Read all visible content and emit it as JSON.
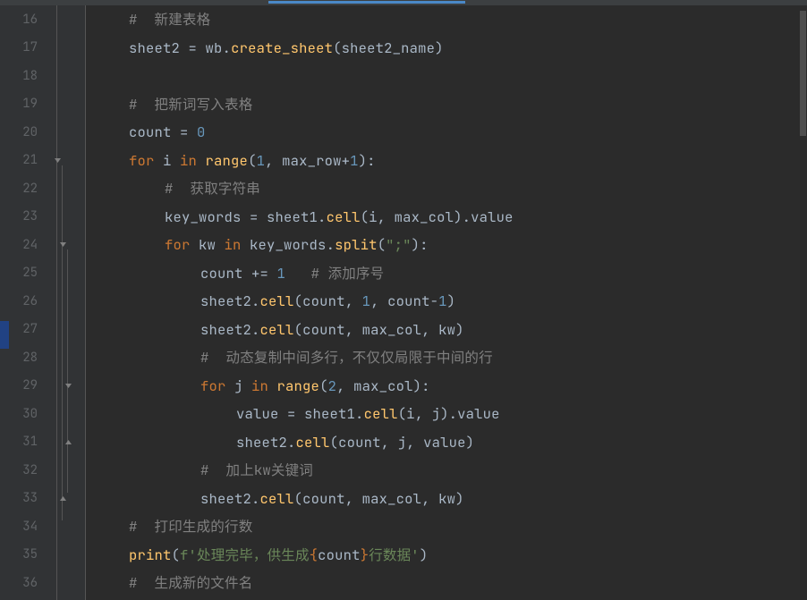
{
  "line_numbers": [
    "16",
    "17",
    "18",
    "19",
    "20",
    "21",
    "22",
    "23",
    "24",
    "25",
    "26",
    "27",
    "28",
    "29",
    "30",
    "31",
    "32",
    "33",
    "34",
    "35",
    "36"
  ],
  "code": {
    "l16": {
      "cmt": "#  新建表格"
    },
    "l17": {
      "v1": "sheet2 ",
      "op1": "= ",
      "v2": "wb",
      "dot": ".",
      "fn": "create_sheet",
      "lp": "(",
      "arg": "sheet2_name",
      "rp": ")"
    },
    "l18": {},
    "l19": {
      "cmt": "#  把新词写入表格"
    },
    "l20": {
      "v": "count ",
      "op": "= ",
      "n": "0"
    },
    "l21": {
      "kw1": "for ",
      "v1": "i ",
      "kw2": "in ",
      "fn": "range",
      "lp": "(",
      "n1": "1",
      "c1": ", ",
      "v2": "max_row",
      "plus": "+",
      "n2": "1",
      "rp": "):"
    },
    "l22": {
      "cmt": "#  获取字符串"
    },
    "l23": {
      "v1": "key_words ",
      "op": "= ",
      "v2": "sheet1",
      "dot1": ".",
      "fn1": "cell",
      "lp": "(",
      "a1": "i",
      "c1": ", ",
      "a2": "max_col",
      "rp": ")",
      "dot2": ".",
      "attr": "value"
    },
    "l24": {
      "kw1": "for ",
      "v1": "kw ",
      "kw2": "in ",
      "v2": "key_words",
      "dot": ".",
      "fn": "split",
      "lp": "(",
      "s": "\";\"",
      "rp": "):"
    },
    "l25": {
      "v": "count ",
      "op": "+= ",
      "n": "1",
      "sp": "   ",
      "cmt": "# 添加序号"
    },
    "l26": {
      "v1": "sheet2",
      "dot": ".",
      "fn": "cell",
      "lp": "(",
      "a1": "count",
      "c1": ", ",
      "n1": "1",
      "c2": ", ",
      "a2": "count",
      "minus": "-",
      "n2": "1",
      "rp": ")"
    },
    "l27": {
      "v1": "sheet2",
      "dot": ".",
      "fn": "cell",
      "lp": "(",
      "a1": "count",
      "c1": ", ",
      "a2": "max_col",
      "c2": ", ",
      "a3": "kw",
      "rp": ")"
    },
    "l28": {
      "cmt": "#  动态复制中间多行，不仅仅局限于中间的行"
    },
    "l29": {
      "kw1": "for ",
      "v1": "j ",
      "kw2": "in ",
      "fn": "range",
      "lp": "(",
      "n1": "2",
      "c1": ", ",
      "a1": "max_col",
      "rp": "):"
    },
    "l30": {
      "v1": "value ",
      "op": "= ",
      "v2": "sheet1",
      "dot": ".",
      "fn": "cell",
      "lp": "(",
      "a1": "i",
      "c1": ", ",
      "a2": "j",
      "rp": ")",
      "dot2": ".",
      "attr": "value"
    },
    "l31": {
      "v1": "sheet2",
      "dot": ".",
      "fn": "cell",
      "lp": "(",
      "a1": "count",
      "c1": ", ",
      "a2": "j",
      "c2": ", ",
      "a3": "value",
      "rp": ")"
    },
    "l32": {
      "cmt": "#  加上kw关键词"
    },
    "l33": {
      "v1": "sheet2",
      "dot": ".",
      "fn": "cell",
      "lp": "(",
      "a1": "count",
      "c1": ", ",
      "a2": "max_col",
      "c2": ", ",
      "a3": "kw",
      "rp": ")"
    },
    "l34": {
      "cmt": "#  打印生成的行数"
    },
    "l35": {
      "fn": "print",
      "lp": "(",
      "f": "f",
      "s1": "'处理完毕，供生成",
      "lb": "{",
      "var": "count",
      "rb": "}",
      "s2": "行数据'",
      "rp": ")"
    },
    "l36": {
      "cmt": "#  生成新的文件名"
    }
  }
}
